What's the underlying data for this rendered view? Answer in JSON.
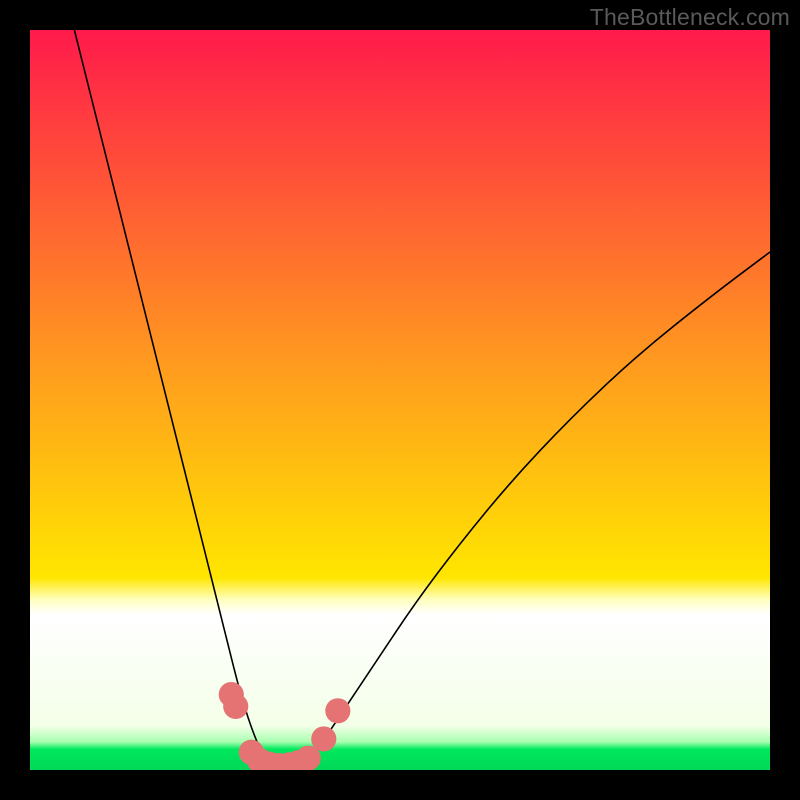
{
  "watermark": "TheBottleneck.com",
  "chart_data": {
    "type": "line",
    "title": "",
    "xlabel": "",
    "ylabel": "",
    "xlim": [
      0,
      100
    ],
    "ylim": [
      0,
      100
    ],
    "background_gradient": {
      "start": "#ff1a4b",
      "mid1": "#ff7a1f",
      "mid2": "#ffe600",
      "end": "#00e85c",
      "stops": [
        0,
        45,
        78,
        100
      ]
    },
    "bottom_band": {
      "white_offset_percent": 77.5,
      "green_offset_percent": 96.5
    },
    "series": [
      {
        "name": "left-curve",
        "x": [
          6,
          9,
          12,
          15,
          18,
          20,
          22,
          24,
          25.5,
          27,
          28,
          29,
          30,
          31,
          31.8,
          32.5
        ],
        "y": [
          100,
          88,
          76,
          64,
          52,
          44,
          36,
          28,
          22,
          16,
          12,
          8.5,
          5.5,
          3,
          1.2,
          0
        ],
        "color": "#000000",
        "stroke_width": 1.6
      },
      {
        "name": "right-curve",
        "x": [
          36.5,
          38,
          40,
          43,
          47,
          52,
          58,
          65,
          73,
          82,
          92,
          100
        ],
        "y": [
          0,
          1.5,
          4.5,
          9,
          15,
          22.5,
          30.5,
          39,
          47.5,
          56,
          64,
          70
        ],
        "color": "#000000",
        "stroke_width": 1.6
      }
    ],
    "markers": [
      {
        "x": 27.2,
        "y": 10.2,
        "r": 1.7,
        "color": "#e57373"
      },
      {
        "x": 27.8,
        "y": 8.6,
        "r": 1.7,
        "color": "#e57373"
      },
      {
        "x": 29.9,
        "y": 2.4,
        "r": 1.7,
        "color": "#e57373"
      },
      {
        "x": 31.0,
        "y": 1.3,
        "r": 1.7,
        "color": "#e57373"
      },
      {
        "x": 32.3,
        "y": 0.8,
        "r": 1.7,
        "color": "#e57373"
      },
      {
        "x": 33.6,
        "y": 0.6,
        "r": 1.7,
        "color": "#e57373"
      },
      {
        "x": 35.0,
        "y": 0.7,
        "r": 1.7,
        "color": "#e57373"
      },
      {
        "x": 36.3,
        "y": 1.0,
        "r": 1.7,
        "color": "#e57373"
      },
      {
        "x": 37.6,
        "y": 1.6,
        "r": 1.7,
        "color": "#e57373"
      },
      {
        "x": 39.7,
        "y": 4.2,
        "r": 1.7,
        "color": "#e57373"
      },
      {
        "x": 41.6,
        "y": 8.0,
        "r": 1.7,
        "color": "#e57373"
      }
    ]
  }
}
